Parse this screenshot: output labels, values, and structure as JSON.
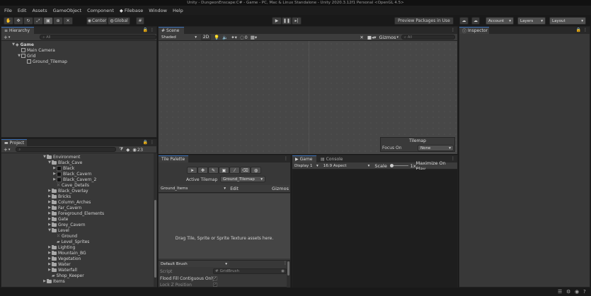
{
  "window": {
    "title": "Unity - DungeonEnscape:C# - Game - PC, Mac & Linux Standalone - Unity 2020.3.12f1 Personal <OpenGL 4.5>"
  },
  "menu": [
    "File",
    "Edit",
    "Assets",
    "GameObject",
    "Component",
    "Filebase",
    "Window",
    "Help"
  ],
  "toolbar": {
    "pivot": "Center",
    "space": "Global",
    "preview_packages": "Preview Packages in Use",
    "account": "Account",
    "layers": "Layers",
    "layout": "Layout"
  },
  "hierarchy": {
    "tab": "Hierarchy",
    "search_placeholder": "All",
    "items": [
      {
        "label": "Game",
        "indent": 0
      },
      {
        "label": "Main Camera",
        "indent": 1
      },
      {
        "label": "Grid",
        "indent": 1
      },
      {
        "label": "Ground_Tilemap",
        "indent": 2
      }
    ]
  },
  "scene": {
    "tab": "Scene",
    "shading": "Shaded",
    "mode": "2D",
    "fx_count": "0",
    "gizmos": "Gizmos",
    "search_placeholder": "All"
  },
  "tilemap_overlay": {
    "title": "Tilemap",
    "focus_label": "Focus On",
    "focus_value": "None"
  },
  "inspector": {
    "tab": "Inspector"
  },
  "project": {
    "tab": "Project",
    "count": "23",
    "items": [
      {
        "label": "Environment",
        "indent": 0,
        "type": "folder",
        "open": true
      },
      {
        "label": "Black_Cave",
        "indent": 1,
        "type": "folder",
        "open": true
      },
      {
        "label": "Black",
        "indent": 2,
        "type": "asset"
      },
      {
        "label": "Black_Cavern",
        "indent": 2,
        "type": "asset"
      },
      {
        "label": "Black_Cavern_2",
        "indent": 2,
        "type": "asset"
      },
      {
        "label": "Cave_Details",
        "indent": 2,
        "type": "grid"
      },
      {
        "label": "Black_Overlay",
        "indent": 1,
        "type": "folder"
      },
      {
        "label": "Bricks",
        "indent": 1,
        "type": "folder"
      },
      {
        "label": "Column_Arches",
        "indent": 1,
        "type": "folder"
      },
      {
        "label": "Far_Cavern",
        "indent": 1,
        "type": "folder"
      },
      {
        "label": "Foreground_Elements",
        "indent": 1,
        "type": "folder"
      },
      {
        "label": "Gate",
        "indent": 1,
        "type": "folder"
      },
      {
        "label": "Grey_Cavern",
        "indent": 1,
        "type": "folder"
      },
      {
        "label": "Level",
        "indent": 1,
        "type": "folder",
        "open": true
      },
      {
        "label": "Ground",
        "indent": 2,
        "type": "grid"
      },
      {
        "label": "Level_Sprites",
        "indent": 2,
        "type": "sprite"
      },
      {
        "label": "Lighting",
        "indent": 1,
        "type": "folder"
      },
      {
        "label": "Mountain_BG",
        "indent": 1,
        "type": "folder"
      },
      {
        "label": "Vegetation",
        "indent": 1,
        "type": "folder"
      },
      {
        "label": "Water",
        "indent": 1,
        "type": "folder"
      },
      {
        "label": "Waterfall",
        "indent": 1,
        "type": "folder"
      },
      {
        "label": "Shop_Keeper",
        "indent": 1,
        "type": "sprite"
      },
      {
        "label": "Items",
        "indent": 0,
        "type": "folder"
      }
    ]
  },
  "tile_palette": {
    "tab": "Tile Palette",
    "active_tilemap_label": "Active Tilemap",
    "active_tilemap_value": "Ground_Tilemap",
    "palette": "Ground_Items",
    "edit": "Edit",
    "gizmos": "Gizmos",
    "empty_message": "Drag Tile, Sprite or Sprite Texture assets here.",
    "brush": "Default Brush",
    "script_label": "Script",
    "script_value": "GridBrush",
    "flood_fill_label": "Flood Fill Contiguous Only",
    "lock_z_label": "Lock Z Position"
  },
  "game": {
    "tab": "Game",
    "console_tab": "Console",
    "display": "Display 1",
    "aspect": "16:9 Aspect",
    "scale_label": "Scale",
    "scale_value": "1x",
    "maximize": "Maximize On Play"
  }
}
